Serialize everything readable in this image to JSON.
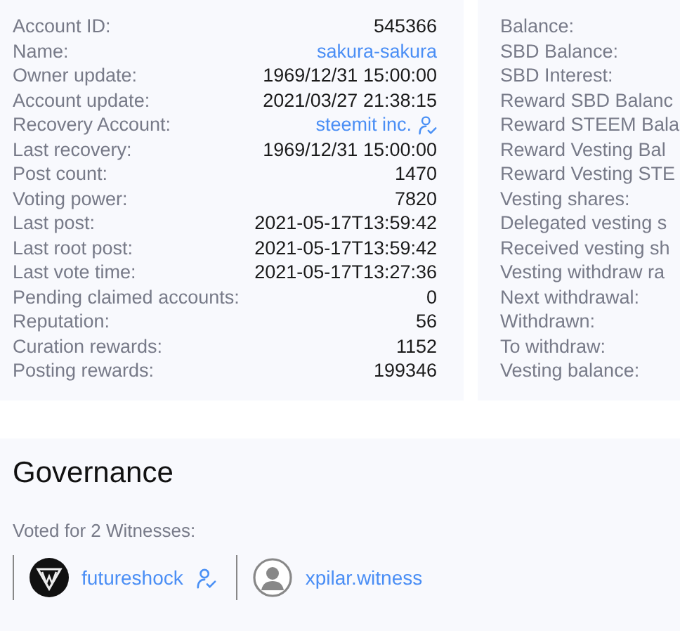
{
  "account_fields": [
    {
      "label": "Account ID:",
      "value": "545366",
      "kind": "text"
    },
    {
      "label": "Name:",
      "value": "sakura-sakura",
      "kind": "link"
    },
    {
      "label": "Owner update:",
      "value": "1969/12/31 15:00:00",
      "kind": "text"
    },
    {
      "label": "Account update:",
      "value": "2021/03/27 21:38:15",
      "kind": "text"
    },
    {
      "label": "Recovery Account:",
      "value": "steemit inc.",
      "kind": "verified-link"
    },
    {
      "label": "Last recovery:",
      "value": "1969/12/31 15:00:00",
      "kind": "text"
    },
    {
      "label": "Post count:",
      "value": "1470",
      "kind": "text"
    },
    {
      "label": "Voting power:",
      "value": "7820",
      "kind": "text"
    },
    {
      "label": "Last post:",
      "value": "2021-05-17T13:59:42",
      "kind": "text"
    },
    {
      "label": "Last root post:",
      "value": "2021-05-17T13:59:42",
      "kind": "text"
    },
    {
      "label": "Last vote time:",
      "value": "2021-05-17T13:27:36",
      "kind": "text"
    },
    {
      "label": "Pending claimed accounts:",
      "value": "0",
      "kind": "text"
    },
    {
      "label": "Reputation:",
      "value": "56",
      "kind": "text"
    },
    {
      "label": "Curation rewards:",
      "value": "1152",
      "kind": "text"
    },
    {
      "label": "Posting rewards:",
      "value": "199346",
      "kind": "text"
    }
  ],
  "balance_fields": [
    "Balance:",
    "SBD Balance:",
    "SBD Interest:",
    "Reward SBD Balanc",
    "Reward STEEM Bala",
    "Reward Vesting Bal",
    "Reward Vesting STE",
    "Vesting shares:",
    "Delegated vesting s",
    "Received vesting sh",
    "Vesting withdraw ra",
    "Next withdrawal:",
    "Withdrawn:",
    "To withdraw:",
    "Vesting balance:"
  ],
  "governance": {
    "title": "Governance",
    "subtitle": "Voted for 2 Witnesses:",
    "witnesses": [
      {
        "name": "futureshock",
        "kind": "logo",
        "verified": true
      },
      {
        "name": "xpilar.witness",
        "kind": "default",
        "verified": false
      }
    ]
  }
}
